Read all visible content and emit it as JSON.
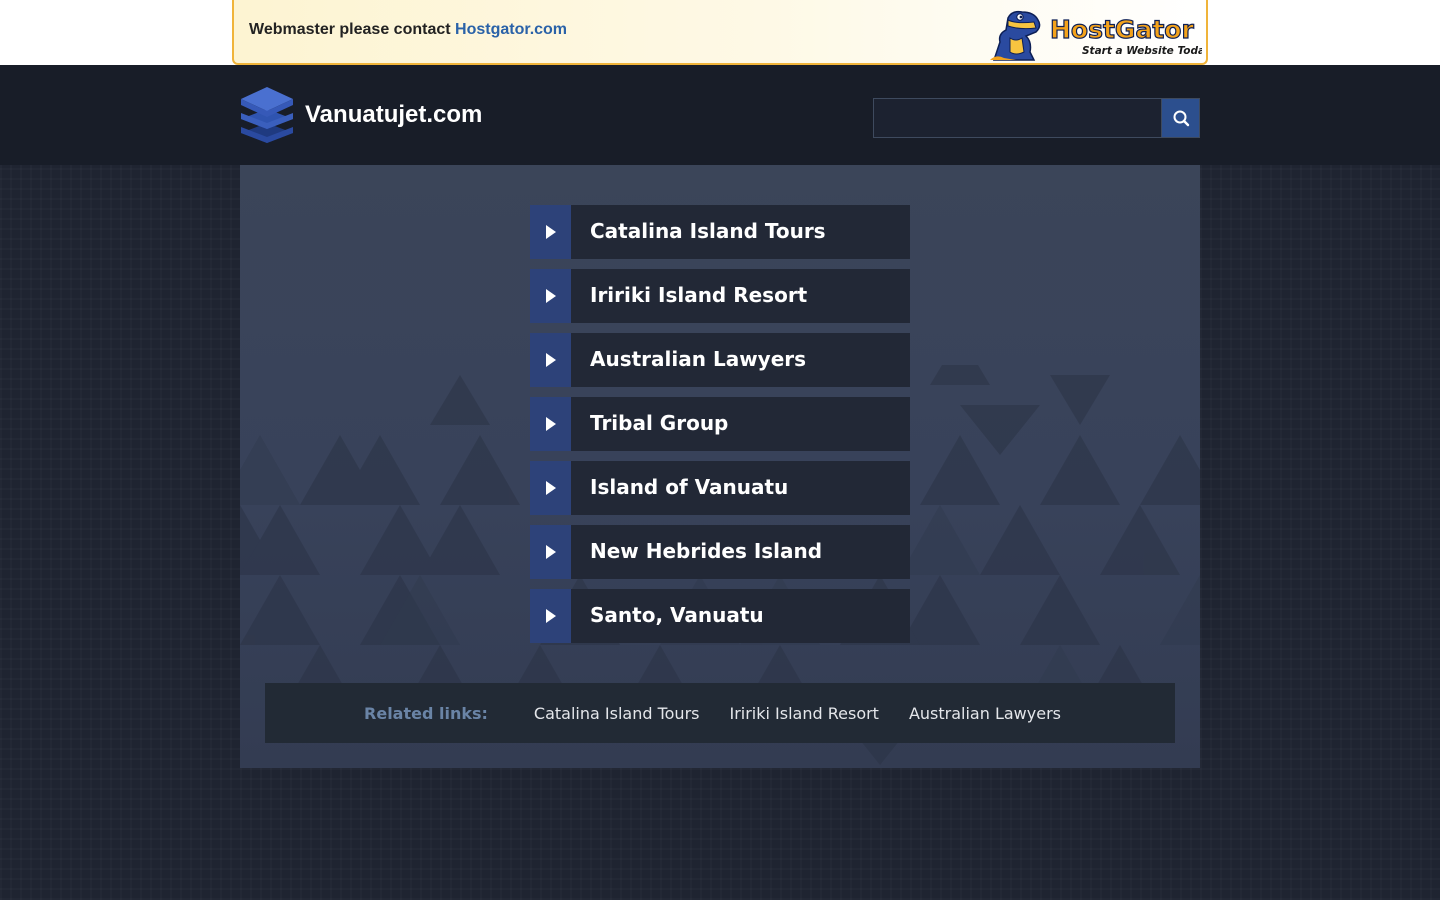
{
  "banner": {
    "text": "Webmaster please contact",
    "link_text": "Hostgator.com",
    "logo_name": "HostGator",
    "logo_tagline": "Start a Website Today!"
  },
  "header": {
    "site_title": "Vanuatujet.com",
    "search_value": ""
  },
  "links": [
    {
      "label": "Catalina Island Tours"
    },
    {
      "label": "Iririki Island Resort"
    },
    {
      "label": "Australian Lawyers"
    },
    {
      "label": "Tribal Group"
    },
    {
      "label": "Island of Vanuatu"
    },
    {
      "label": "New Hebrides Island"
    },
    {
      "label": "Santo, Vanuatu"
    }
  ],
  "related": {
    "label": "Related links:",
    "links": [
      "Catalina Island Tours",
      "Iririki Island Resort",
      "Australian Lawyers"
    ]
  },
  "colors": {
    "header_bg": "#181d28",
    "accent_blue": "#2d4279",
    "link_bg": "#222836",
    "banner_border": "#f0b43a",
    "hostgator_link": "#2a62a8"
  }
}
